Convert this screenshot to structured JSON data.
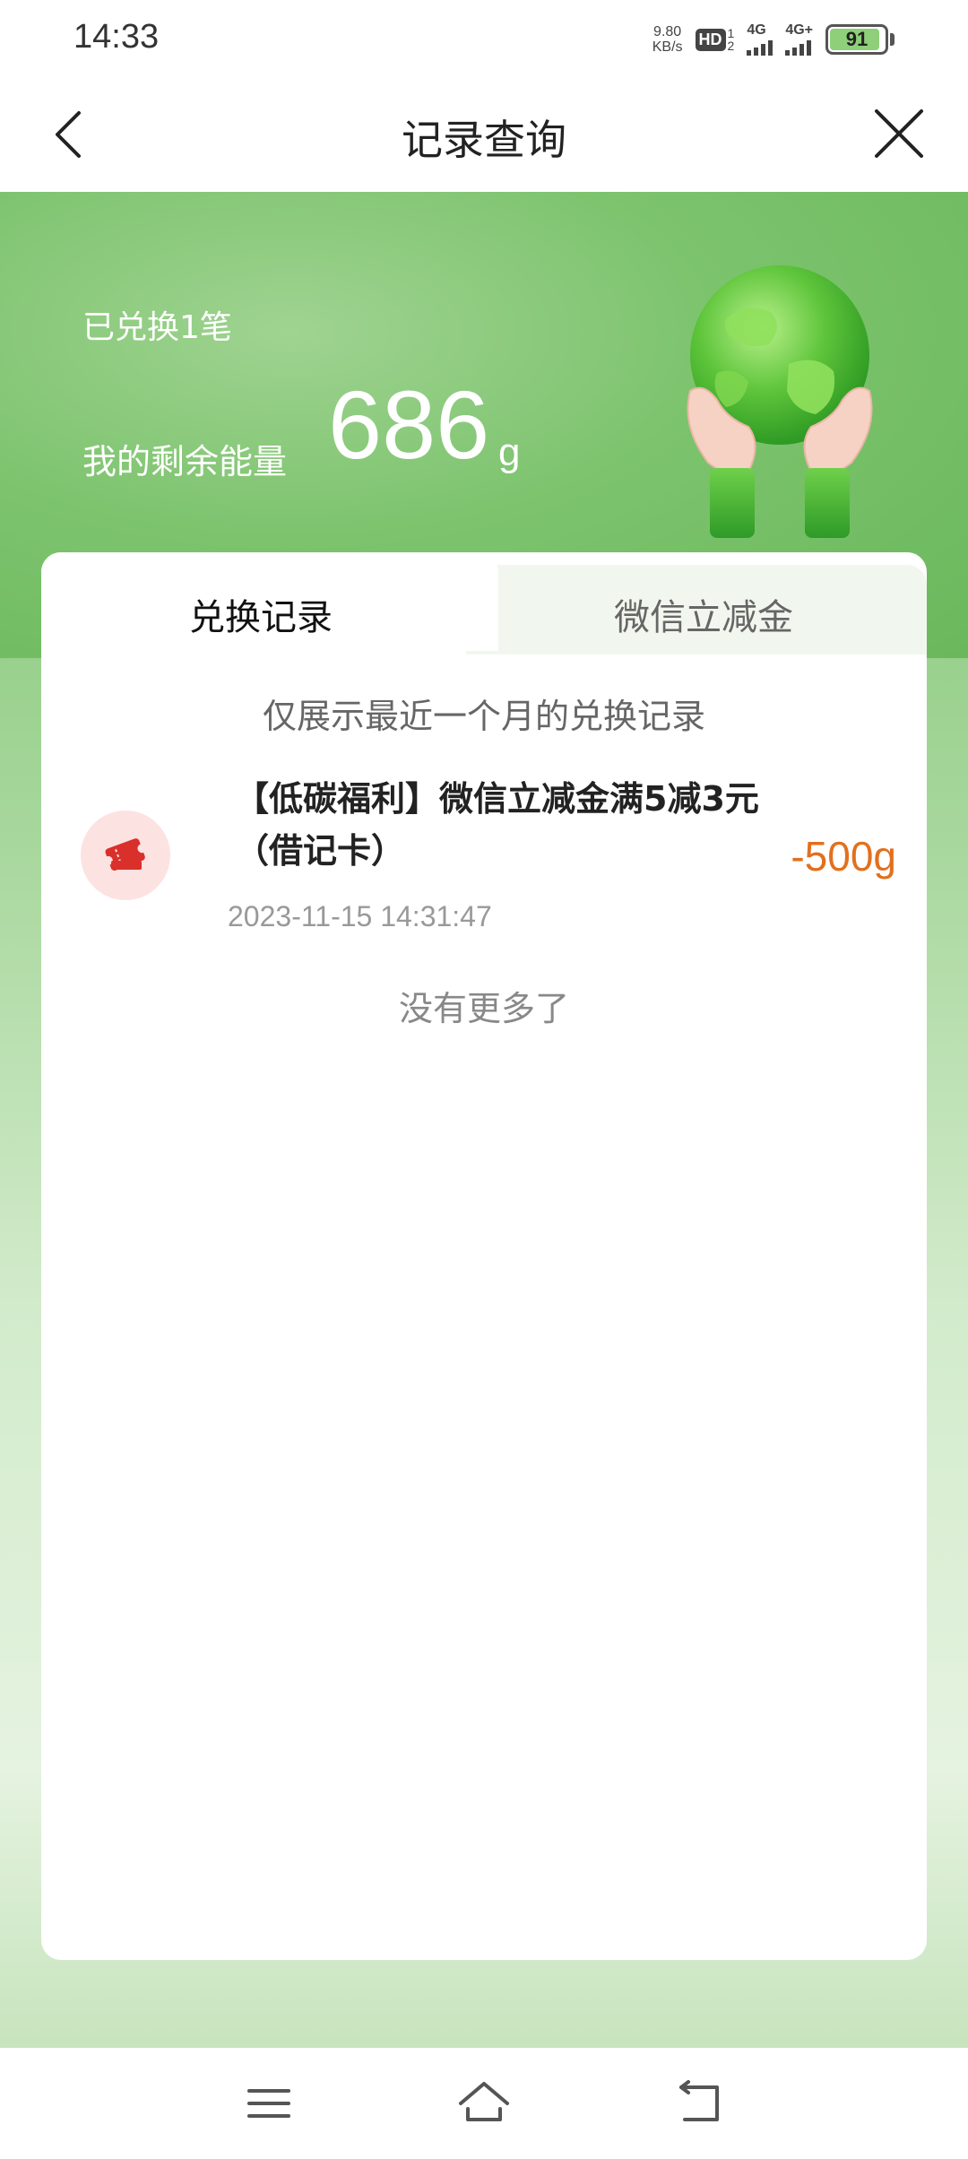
{
  "status_bar": {
    "time": "14:33",
    "net_speed_value": "9.80",
    "net_speed_unit": "KB/s",
    "hd_label": "HD",
    "hd_sub_top": "1",
    "hd_sub_bottom": "2",
    "signal1_label": "4G",
    "signal2_label": "4G+",
    "battery_level": "91",
    "icons": [
      "hd-icon",
      "signal-icon",
      "battery-icon"
    ]
  },
  "navbar": {
    "title": "记录查询",
    "back_icon": "chevron-left-icon",
    "close_icon": "close-icon"
  },
  "header": {
    "exchanged_count": "已兑换1笔",
    "energy_label": "我的剩余能量",
    "energy_value": "686",
    "energy_unit": "g",
    "illustration": "globe-in-hands"
  },
  "tabs": [
    {
      "label": "兑换记录",
      "active": true
    },
    {
      "label": "微信立减金",
      "active": false
    }
  ],
  "notice": "仅展示最近一个月的兑换记录",
  "records": [
    {
      "title_line1": "【低碳福利】微信立减金满5减3元",
      "title_line2": "（借记卡）",
      "amount": "-500g",
      "time": "2023-11-15 14:31:47",
      "icon": "coupon-icon"
    }
  ],
  "no_more": "没有更多了",
  "system_nav": {
    "icons": [
      "menu-icon",
      "home-icon",
      "back-icon"
    ]
  },
  "colors": {
    "accent_green": "#6ab85c",
    "amount_orange": "#e2701e",
    "coupon_red": "#d9302b"
  }
}
